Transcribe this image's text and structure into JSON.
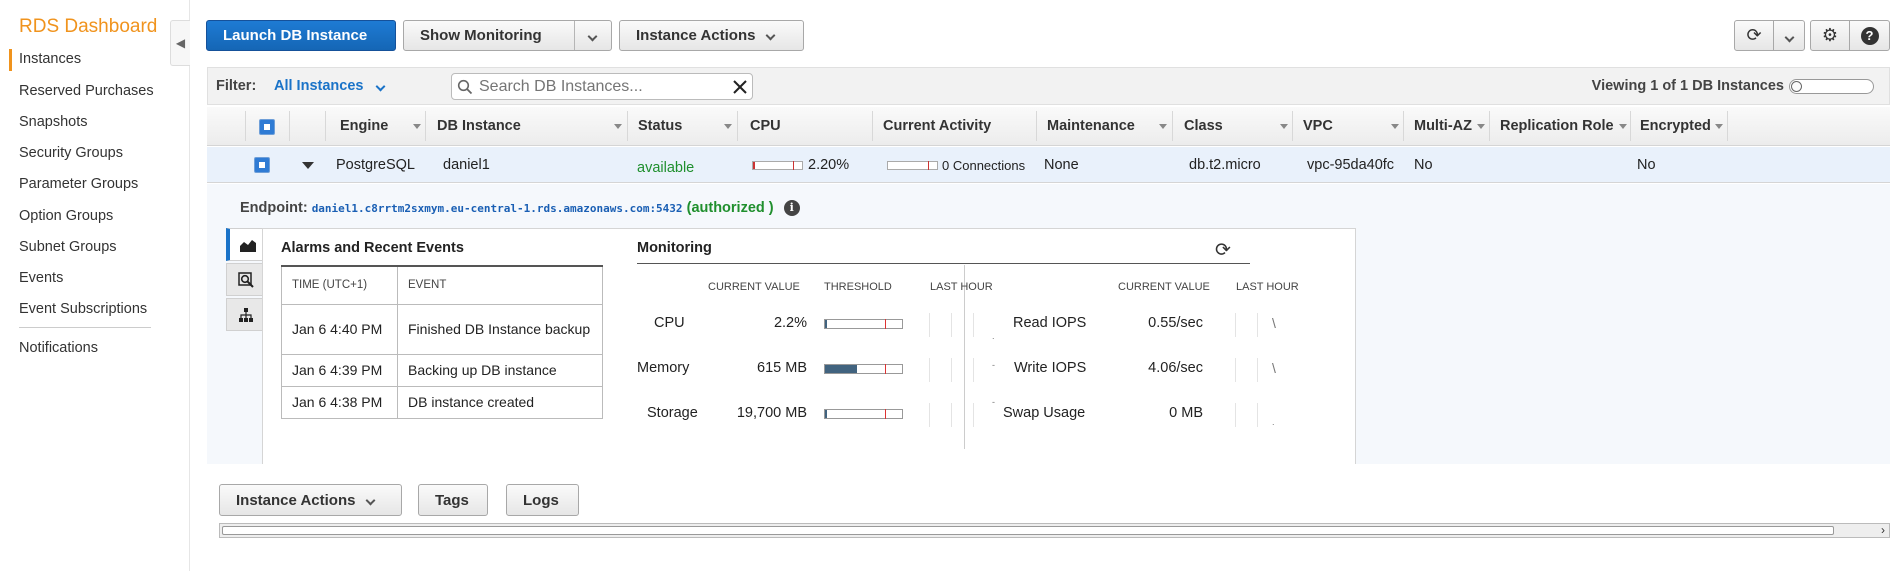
{
  "sidebar": {
    "title": "RDS Dashboard",
    "items": [
      {
        "label": "Instances"
      },
      {
        "label": "Reserved Purchases"
      },
      {
        "label": "Snapshots"
      },
      {
        "label": "Security Groups"
      },
      {
        "label": "Parameter Groups"
      },
      {
        "label": "Option Groups"
      },
      {
        "label": "Subnet Groups"
      },
      {
        "label": "Events"
      },
      {
        "label": "Event Subscriptions"
      },
      {
        "label": "Notifications"
      }
    ]
  },
  "toolbar": {
    "launch_label": "Launch DB Instance",
    "monitoring_label": "Show Monitoring",
    "actions_label": "Instance Actions"
  },
  "filter": {
    "label": "Filter:",
    "value": "All Instances",
    "search_placeholder": "Search DB Instances...",
    "viewing": "Viewing 1 of 1 DB Instances"
  },
  "table": {
    "headers": [
      "Engine",
      "DB Instance",
      "Status",
      "CPU",
      "Current Activity",
      "Maintenance",
      "Class",
      "VPC",
      "Multi-AZ",
      "Replication Role",
      "Encrypted"
    ],
    "row": {
      "engine": "PostgreSQL",
      "db_instance": "daniel1",
      "status": "available",
      "cpu": "2.20%",
      "activity": "0 Connections",
      "maintenance": "None",
      "class": "db.t2.micro",
      "vpc": "vpc-95da40fc",
      "multi_az": "No",
      "replication_role": "",
      "encrypted": "No"
    }
  },
  "details": {
    "endpoint_label": "Endpoint:",
    "endpoint_url": "daniel1.c8rrtm2sxmym.eu-central-1.rds.amazonaws.com:5432",
    "auth_open": "(",
    "auth_status": "authorized",
    "auth_close": ")",
    "alarms": {
      "title": "Alarms and Recent Events",
      "col_time": "TIME (UTC+1)",
      "col_event": "EVENT",
      "rows": [
        {
          "time": "Jan 6 4:40 PM",
          "event": "Finished DB Instance backup"
        },
        {
          "time": "Jan 6 4:39 PM",
          "event": "Backing up DB instance"
        },
        {
          "time": "Jan 6 4:38 PM",
          "event": "DB instance created"
        }
      ]
    },
    "monitoring": {
      "title": "Monitoring",
      "col_current": "CURRENT VALUE",
      "col_threshold": "THRESHOLD",
      "col_last_hour": "LAST HOUR",
      "left": [
        {
          "label": "CPU",
          "value": "2.2%",
          "fill": 0.02
        },
        {
          "label": "Memory",
          "value": "615 MB",
          "fill": 0.42
        },
        {
          "label": "Storage",
          "value": "19,700 MB",
          "fill": 0.02
        }
      ],
      "right": [
        {
          "label": "Read IOPS",
          "value": "0.55/sec"
        },
        {
          "label": "Write IOPS",
          "value": "4.06/sec"
        },
        {
          "label": "Swap Usage",
          "value": "0 MB"
        }
      ]
    }
  },
  "bottom": {
    "actions_label": "Instance Actions",
    "tags_label": "Tags",
    "logs_label": "Logs"
  },
  "colors": {
    "brand": "#f0931d",
    "primary": "#1e7bd4",
    "available": "#1f8f2d"
  }
}
